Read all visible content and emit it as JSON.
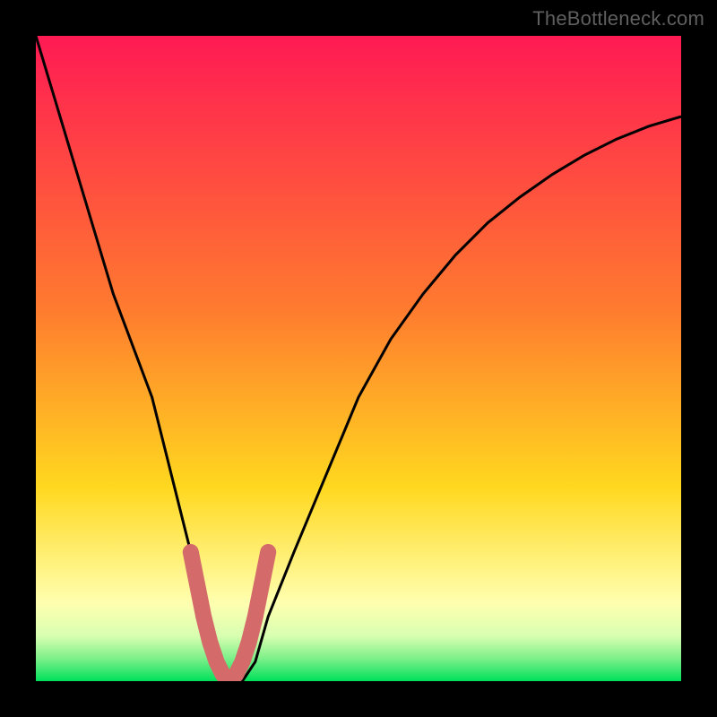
{
  "watermark": "TheBottleneck.com",
  "colors": {
    "bg": "#000000",
    "grad_top": "#ff1a54",
    "grad_mid1": "#ff7a2f",
    "grad_mid2": "#ffd81f",
    "grad_pale": "#ffffb0",
    "grad_bottom": "#00e05a",
    "curve": "#000000",
    "marker": "#d46a6a"
  },
  "chart_data": {
    "type": "line",
    "title": "",
    "xlabel": "",
    "ylabel": "",
    "xlim": [
      0,
      100
    ],
    "ylim": [
      0,
      100
    ],
    "series": [
      {
        "name": "curve",
        "x": [
          0,
          3,
          6,
          9,
          12,
          15,
          18,
          21,
          24,
          26,
          28,
          30,
          32,
          34,
          36,
          40,
          45,
          50,
          55,
          60,
          65,
          70,
          75,
          80,
          85,
          90,
          95,
          100
        ],
        "y": [
          100,
          90,
          80,
          70,
          60,
          52,
          44,
          32,
          20,
          10,
          3,
          0,
          0,
          3,
          10,
          20,
          32,
          44,
          53,
          60,
          66,
          71,
          75,
          78.5,
          81.5,
          84,
          86,
          87.5
        ]
      },
      {
        "name": "marker",
        "x": [
          24,
          25,
          26,
          27,
          28,
          29,
          30,
          31,
          32,
          33,
          34,
          35,
          36
        ],
        "y": [
          20,
          15,
          10,
          6,
          3,
          1,
          0,
          1,
          3,
          6,
          10,
          15,
          20
        ]
      }
    ],
    "gradient_bands": [
      {
        "y": 100,
        "color": "#ff1a54"
      },
      {
        "y": 55,
        "color": "#ffb020"
      },
      {
        "y": 30,
        "color": "#ffe533"
      },
      {
        "y": 12,
        "color": "#ffffb0"
      },
      {
        "y": 0,
        "color": "#00e05a"
      }
    ]
  }
}
